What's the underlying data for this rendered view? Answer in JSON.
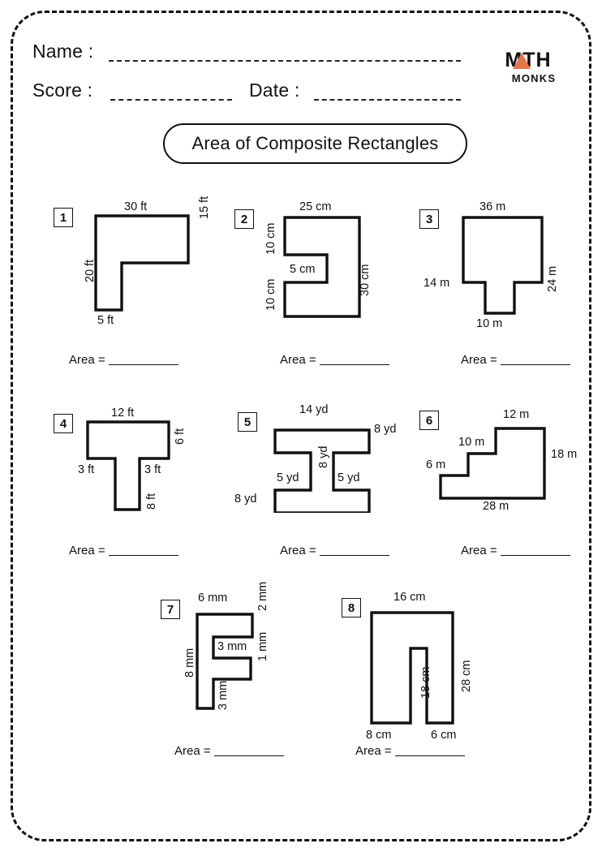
{
  "header": {
    "name_label": "Name :",
    "score_label": "Score :",
    "date_label": "Date :",
    "logo_main": "MTH",
    "logo_sub": "MONKS",
    "logo_accent_color": "#e8744c"
  },
  "title": "Area of Composite Rectangles",
  "area_label": "Area =",
  "problems": [
    {
      "number": "1",
      "shape": "L-shape",
      "dims": [
        "30 ft",
        "15 ft",
        "5 ft",
        "20 ft"
      ],
      "top": "30 ft",
      "right": "15 ft",
      "bottom": "5 ft",
      "left": "20 ft",
      "unit": "ft"
    },
    {
      "number": "2",
      "shape": "C-shape-notch",
      "dims": [
        "25 cm",
        "30 cm",
        "10 cm",
        "5 cm",
        "10 cm"
      ],
      "top": "25 cm",
      "right": "30 cm",
      "upper_left": "10 cm",
      "notch": "5 cm",
      "lower_left": "10 cm",
      "unit": "cm"
    },
    {
      "number": "3",
      "shape": "T-shape-tab-down",
      "dims": [
        "36 m",
        "24 m",
        "10 m",
        "14 m"
      ],
      "top": "36 m",
      "right": "24 m",
      "bottom": "10 m",
      "left_step": "14 m",
      "unit": "m"
    },
    {
      "number": "4",
      "shape": "T-shape",
      "dims": [
        "12 ft",
        "6 ft",
        "3 ft",
        "3 ft",
        "8 ft"
      ],
      "top": "12 ft",
      "right": "6 ft",
      "left_arm": "3 ft",
      "right_arm": "3 ft",
      "stem": "8 ft",
      "unit": "ft"
    },
    {
      "number": "5",
      "shape": "I-beam",
      "dims": [
        "14 yd",
        "8 yd",
        "8 yd",
        "5 yd",
        "5 yd",
        "8 yd"
      ],
      "top": "14 yd",
      "top_right": "8 yd",
      "web": "8 yd",
      "left_gap": "5 yd",
      "right_gap": "5 yd",
      "bottom_left": "8 yd",
      "unit": "yd"
    },
    {
      "number": "6",
      "shape": "staircase",
      "dims": [
        "12 m",
        "10 m",
        "6 m",
        "18 m",
        "28 m"
      ],
      "top": "12 m",
      "step2": "10 m",
      "step1": "6 m",
      "right": "18 m",
      "bottom": "28 m",
      "unit": "m"
    },
    {
      "number": "7",
      "shape": "F-shape",
      "dims": [
        "6 mm",
        "2 mm",
        "3 mm",
        "1 mm",
        "3 mm",
        "8 mm"
      ],
      "top": "6 mm",
      "upper_right": "2 mm",
      "mid": "3 mm",
      "lower_right": "1 mm",
      "stem": "3 mm",
      "left": "8 mm",
      "unit": "mm"
    },
    {
      "number": "8",
      "shape": "U-shape",
      "dims": [
        "16 cm",
        "28 cm",
        "18 cm",
        "8 cm",
        "6 cm"
      ],
      "top": "16 cm",
      "right": "28 cm",
      "slot": "18 cm",
      "bottom_left": "8 cm",
      "bottom_right": "6 cm",
      "unit": "cm"
    }
  ]
}
